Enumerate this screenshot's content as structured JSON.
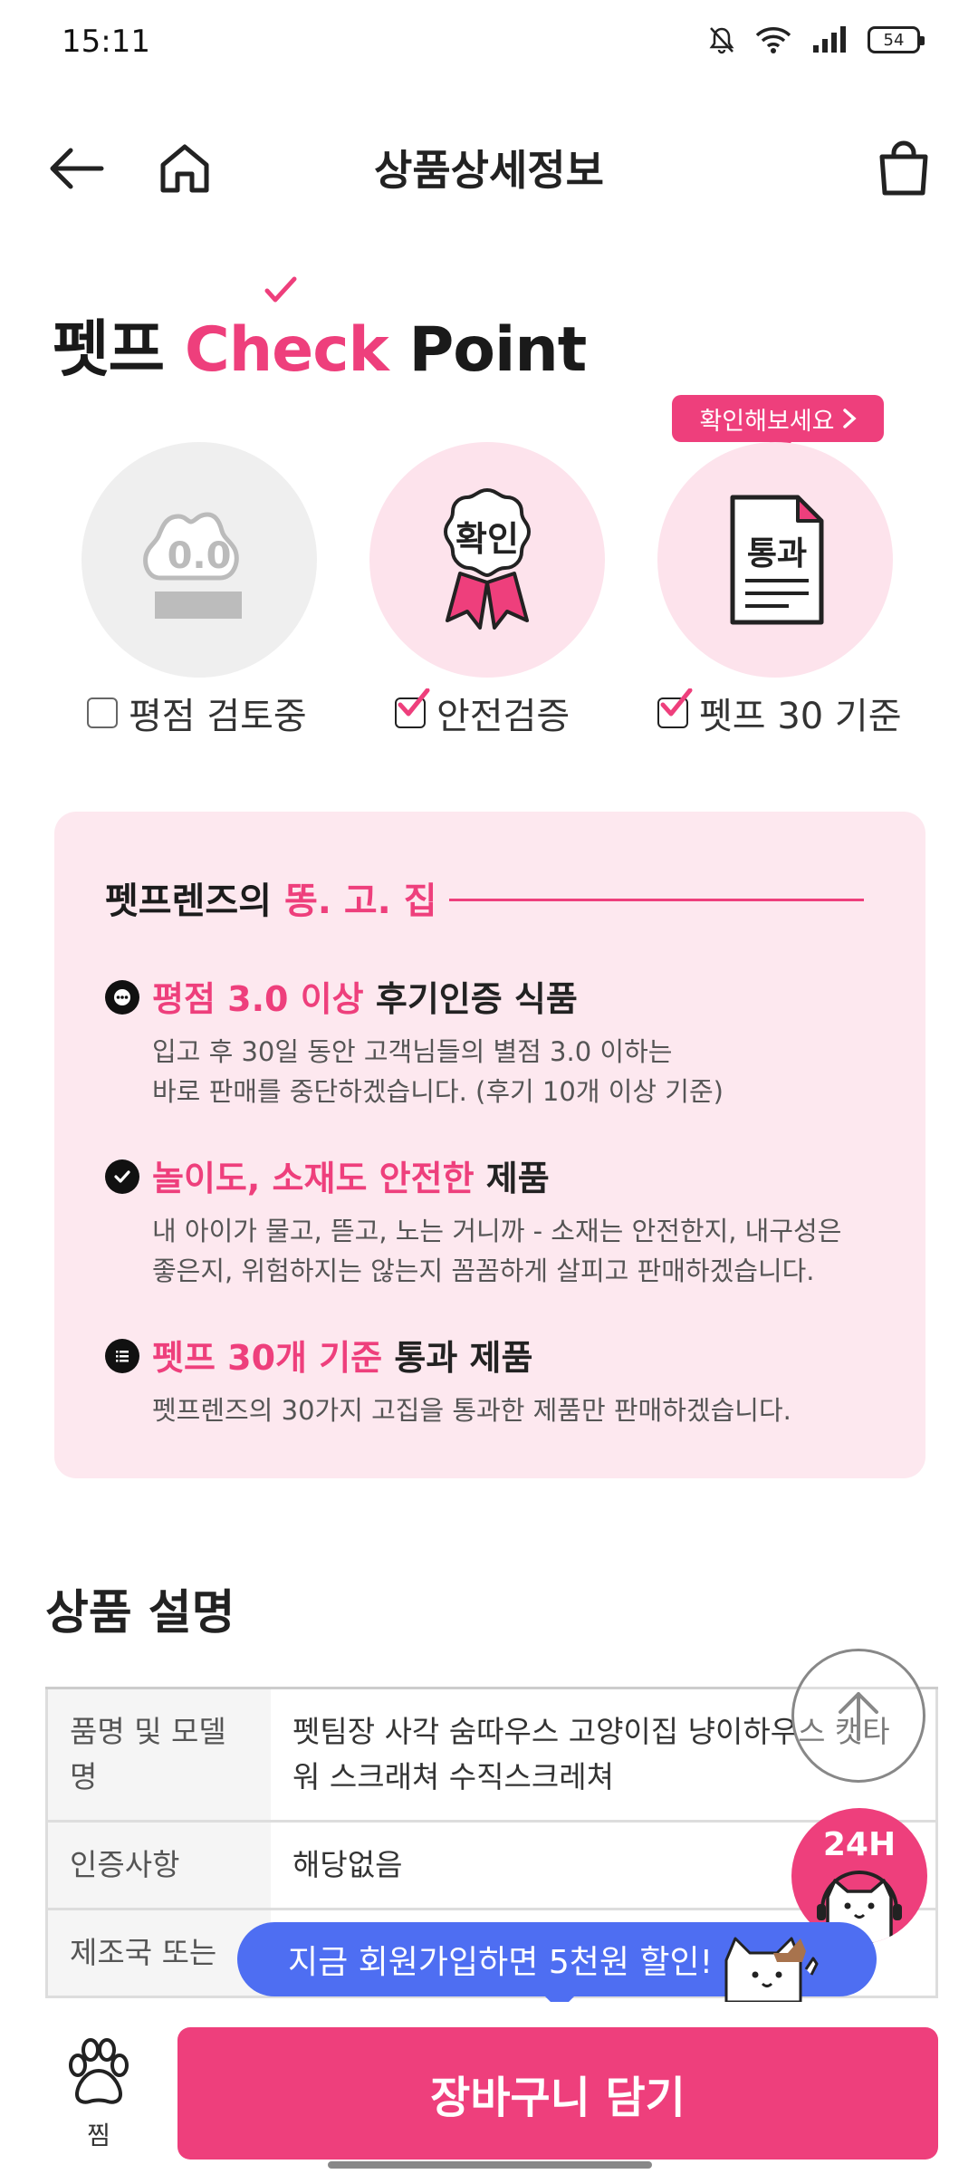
{
  "status_bar": {
    "time": "15:11",
    "battery": "54"
  },
  "header": {
    "title": "상품상세정보"
  },
  "check_point": {
    "title_prefix": "펫프",
    "title_brand": "Check",
    "title_suffix": "Point",
    "tooltip": "확인해보세요",
    "badges": [
      {
        "icon_text": "0.0",
        "label": "평점 검토중",
        "checked": false
      },
      {
        "icon_text": "확인",
        "label": "안전검증",
        "checked": true
      },
      {
        "icon_text": "통과",
        "label": "펫프 30 기준",
        "checked": true
      }
    ]
  },
  "panel": {
    "head_prefix": "펫프렌즈의",
    "head_highlight": "똥. 고. 집",
    "items": [
      {
        "highlight": "평점 3.0 이상",
        "rest": "후기인증 식품",
        "desc_line1": "입고 후 30일 동안 고객님들의 별점 3.0 이하는",
        "desc_line2": "바로 판매를 중단하겠습니다. (후기 10개 이상 기준)"
      },
      {
        "highlight": "놀이도, 소재도 안전한",
        "rest": "제품",
        "desc_line1": "내 아이가 물고, 뜯고, 노는 거니까 - 소재는 안전한지, 내구성은",
        "desc_line2": "좋은지, 위험하지는 않는지 꼼꼼하게 살피고 판매하겠습니다."
      },
      {
        "highlight": "펫프 30개 기준",
        "rest": "통과 제품",
        "desc_line1": "펫프렌즈의 30가지 고집을 통과한 제품만 판매하겠습니다."
      }
    ]
  },
  "product": {
    "section_title": "상품 설명",
    "rows": [
      {
        "key": "품명 및 모델명",
        "value": "펫팀장 사각 숨따우스 고양이집 냥이하우스 캣타워 스크래쳐 수직스크레쳐"
      },
      {
        "key": "인증사항",
        "value": "해당없음"
      },
      {
        "key": "제조국 또는",
        "value": ""
      }
    ]
  },
  "floating": {
    "cs_label": "24H",
    "promo_text": "지금 회원가입하면 5천원 할인!"
  },
  "bottom_bar": {
    "wish_label": "찜",
    "cart_label": "장바구니 담기"
  },
  "colors": {
    "accent": "#ee3f7c",
    "panel_bg": "#fde8ef",
    "promo": "#4e6ef2"
  }
}
